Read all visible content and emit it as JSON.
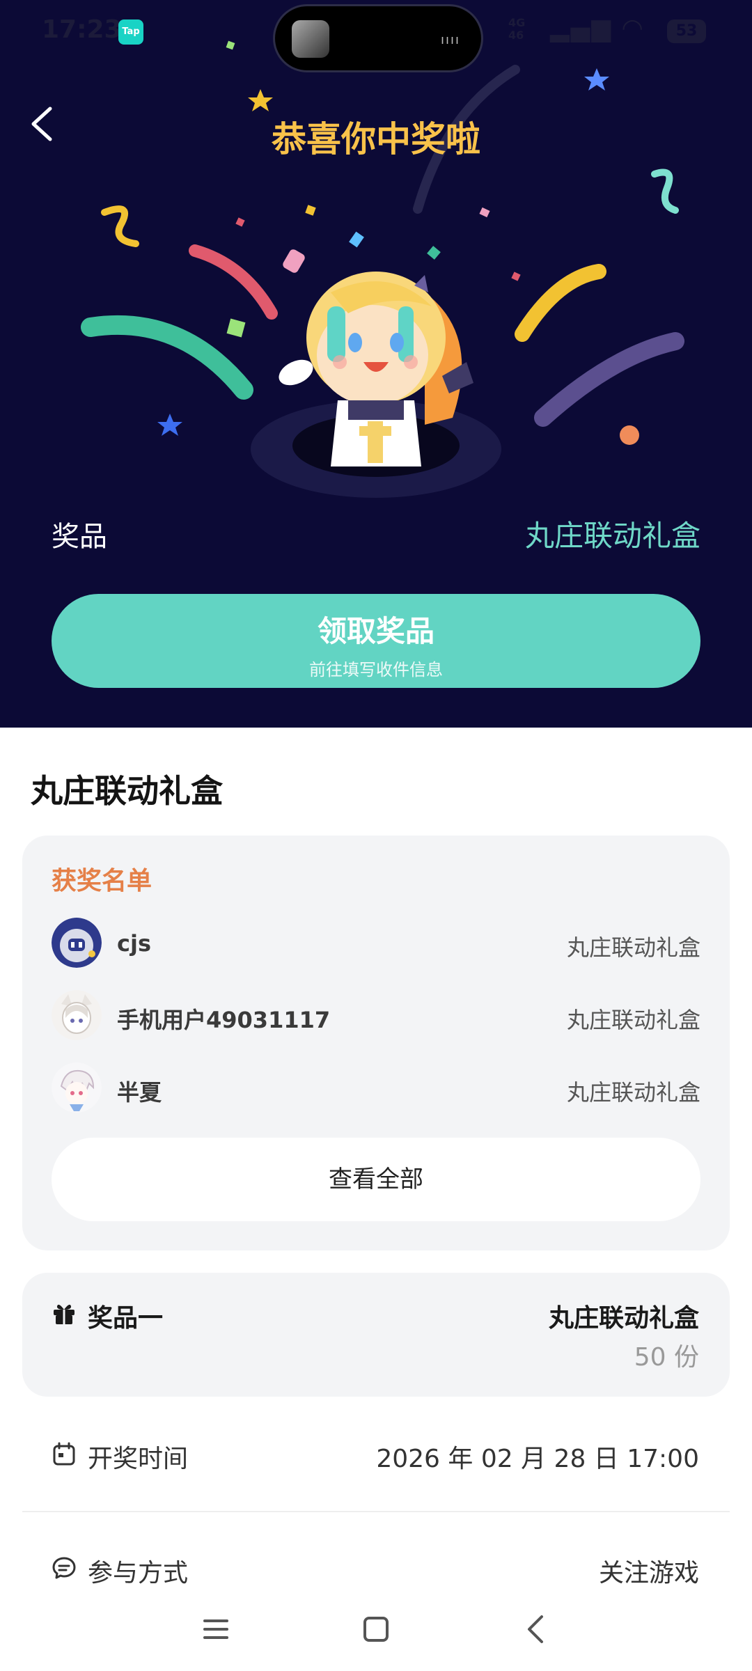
{
  "status_bar": {
    "time": "17:23",
    "app_badge": "Tap",
    "signal_text": "4G\n46",
    "battery": "53"
  },
  "header": {
    "title": "恭喜你中奖啦"
  },
  "prize": {
    "label": "奖品",
    "value": "丸庄联动礼盒"
  },
  "claim": {
    "label": "领取奖品",
    "sublabel": "前往填写收件信息"
  },
  "section_title": "丸庄联动礼盒",
  "winners": {
    "heading": "获奖名单",
    "rows": [
      {
        "name": "cjs",
        "prize": "丸庄联动礼盒"
      },
      {
        "name": "手机用户49031117",
        "prize": "丸庄联动礼盒"
      },
      {
        "name": "半夏",
        "prize": "丸庄联动礼盒"
      }
    ],
    "view_all": "查看全部"
  },
  "prize_one": {
    "label": "奖品一",
    "name": "丸庄联动礼盒",
    "count": "50 份"
  },
  "draw_time": {
    "label": "开奖时间",
    "value": "2026 年 02 月 28 日 17:00"
  },
  "participation": {
    "label": "参与方式",
    "value": "关注游戏"
  },
  "colors": {
    "hero_bg": "#0c0a36",
    "accent": "#62d4c3",
    "title_gold": "#f9c24a",
    "winners_orange": "#e58048"
  }
}
